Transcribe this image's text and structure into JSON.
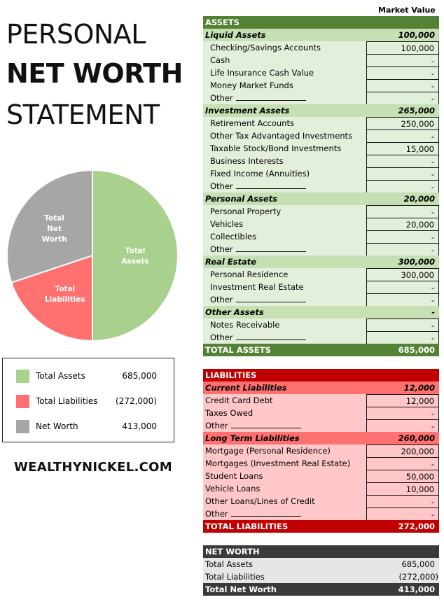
{
  "title": {
    "line1": "PERSONAL",
    "line2": "NET WORTH",
    "line3": "STATEMENT"
  },
  "brand": "WEALTHYNICKEL.COM",
  "column_header": "Market Value",
  "colors": {
    "assets": "#a9d18e",
    "liabilities": "#ff7171",
    "net_worth": "#a6a6a6"
  },
  "chart_data": {
    "type": "pie",
    "title": "",
    "slices": [
      {
        "label": "Total Assets",
        "value": 685000,
        "color": "#a9d18e"
      },
      {
        "label": "Total Liabilities",
        "value": 272000,
        "color": "#ff7171"
      },
      {
        "label": "Total Net Worth",
        "value": 413000,
        "color": "#a6a6a6"
      }
    ],
    "slice_labels": [
      [
        "Total",
        "Assets"
      ],
      [
        "Total",
        "Liabilities"
      ],
      [
        "Total",
        "Net",
        "Worth"
      ]
    ]
  },
  "legend": [
    {
      "label": "Total Assets",
      "value": "685,000",
      "color": "#a9d18e"
    },
    {
      "label": "Total Liabilities",
      "value": "(272,000)",
      "color": "#ff7171"
    },
    {
      "label": "Net Worth",
      "value": "413,000",
      "color": "#a6a6a6"
    }
  ],
  "assets": {
    "header": "ASSETS",
    "groups": [
      {
        "name": "Liquid Assets",
        "total": "100,000",
        "items": [
          {
            "label": "Checking/Savings Accounts",
            "value": "100,000"
          },
          {
            "label": "Cash",
            "value": "-"
          },
          {
            "label": "Life Insurance Cash Value",
            "value": "-"
          },
          {
            "label": "Money Market Funds",
            "value": "-"
          },
          {
            "label": "Other",
            "value": "-",
            "blank": true
          }
        ]
      },
      {
        "name": "Investment Assets",
        "total": "265,000",
        "items": [
          {
            "label": "Retirement Accounts",
            "value": "250,000"
          },
          {
            "label": "Other Tax Advantaged Investments",
            "value": "-"
          },
          {
            "label": "Taxable Stock/Bond Investments",
            "value": "15,000"
          },
          {
            "label": "Business Interests",
            "value": "-"
          },
          {
            "label": "Fixed Income (Annuities)",
            "value": "-"
          },
          {
            "label": "Other",
            "value": "-",
            "blank": true
          }
        ]
      },
      {
        "name": "Personal Assets",
        "total": "20,000",
        "items": [
          {
            "label": "Personal Property",
            "value": "-"
          },
          {
            "label": "Vehicles",
            "value": "20,000"
          },
          {
            "label": "Collectibles",
            "value": "-"
          },
          {
            "label": "Other",
            "value": "-",
            "blank": true
          }
        ]
      },
      {
        "name": "Real Estate",
        "total": "300,000",
        "items": [
          {
            "label": "Personal Residence",
            "value": "300,000"
          },
          {
            "label": "Investment Real Estate",
            "value": "-"
          },
          {
            "label": "Other",
            "value": "-",
            "blank": true
          }
        ]
      },
      {
        "name": "Other Assets",
        "total": "-",
        "items": [
          {
            "label": "Notes Receivable",
            "value": "-"
          },
          {
            "label": "Other",
            "value": "-",
            "blank": true
          }
        ]
      }
    ],
    "total_label": "TOTAL ASSETS",
    "total_value": "685,000"
  },
  "liabilities": {
    "header": "LIABILITIES",
    "groups": [
      {
        "name": "Current Liabilities",
        "total": "12,000",
        "items": [
          {
            "label": "Credit Card Debt",
            "value": "12,000"
          },
          {
            "label": "Taxes Owed",
            "value": "-"
          },
          {
            "label": "Other",
            "value": "-",
            "blank": true
          }
        ]
      },
      {
        "name": "Long Term Liabilities",
        "total": "260,000",
        "items": [
          {
            "label": "Mortgage (Personal Residence)",
            "value": "200,000"
          },
          {
            "label": "Mortgages (Investment Real Estate)",
            "value": "-"
          },
          {
            "label": "Student Loans",
            "value": "50,000"
          },
          {
            "label": "Vehicle Loans",
            "value": "10,000"
          },
          {
            "label": "Other Loans/Lines of Credit",
            "value": "-"
          },
          {
            "label": "Other",
            "value": "-",
            "blank": true
          }
        ]
      }
    ],
    "total_label": "TOTAL LIABILITIES",
    "total_value": "272,000"
  },
  "net_worth": {
    "header": "NET WORTH",
    "rows": [
      {
        "label": "Total Assets",
        "value": "685,000"
      },
      {
        "label": "Total Liabilities",
        "value": "(272,000)"
      }
    ],
    "total_label": "Total Net Worth",
    "total_value": "413,000"
  }
}
